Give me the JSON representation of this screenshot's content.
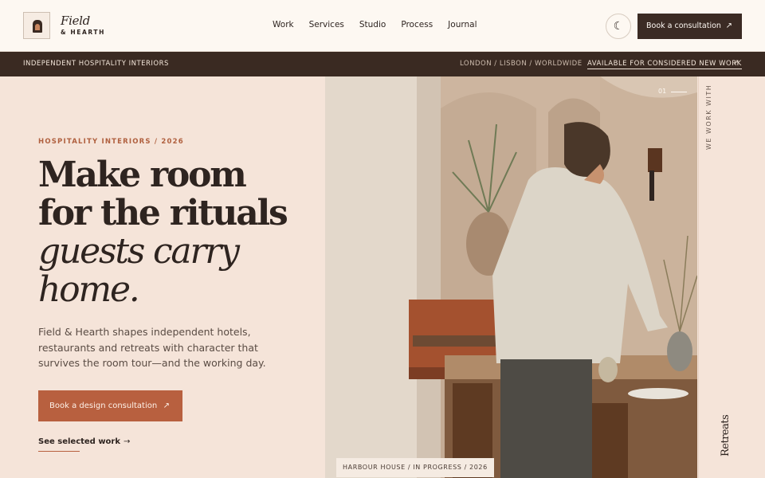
{
  "brand": {
    "name_line1": "Field",
    "name_line2": "& HEARTH"
  },
  "nav": {
    "items": [
      "Work",
      "Services",
      "Studio",
      "Process",
      "Journal"
    ],
    "cta": "Book a consultation"
  },
  "band": {
    "left": "INDEPENDENT HOSPITALITY INTERIORS",
    "middle": "LONDON / LISBON / WORLDWIDE",
    "right": "AVAILABLE FOR CONSIDERED NEW WORK"
  },
  "hero": {
    "eyebrow": "HOSPITALITY INTERIORS / 2026",
    "headline_line1": "Make room",
    "headline_line2": "for the rituals",
    "headline_italic1": "guests carry",
    "headline_italic2": "home.",
    "body": "Field & Hearth shapes independent hotels, restaurants and retreats with character that survives the room tour—and the working day.",
    "primary_cta": "Book a design consultation",
    "secondary_cta": "See selected work"
  },
  "photo": {
    "index": "01",
    "caption": "HARBOUR HOUSE / IN PROGRESS / 2026"
  },
  "rail": {
    "label": "WE WORK WITH",
    "word": "Retreats"
  },
  "icons": {
    "theme": "moon-icon",
    "arrow": "arrow-up-right-icon"
  },
  "colors": {
    "accent": "#b8603f",
    "dark": "#3a2a22",
    "background": "#f5e4d9"
  }
}
